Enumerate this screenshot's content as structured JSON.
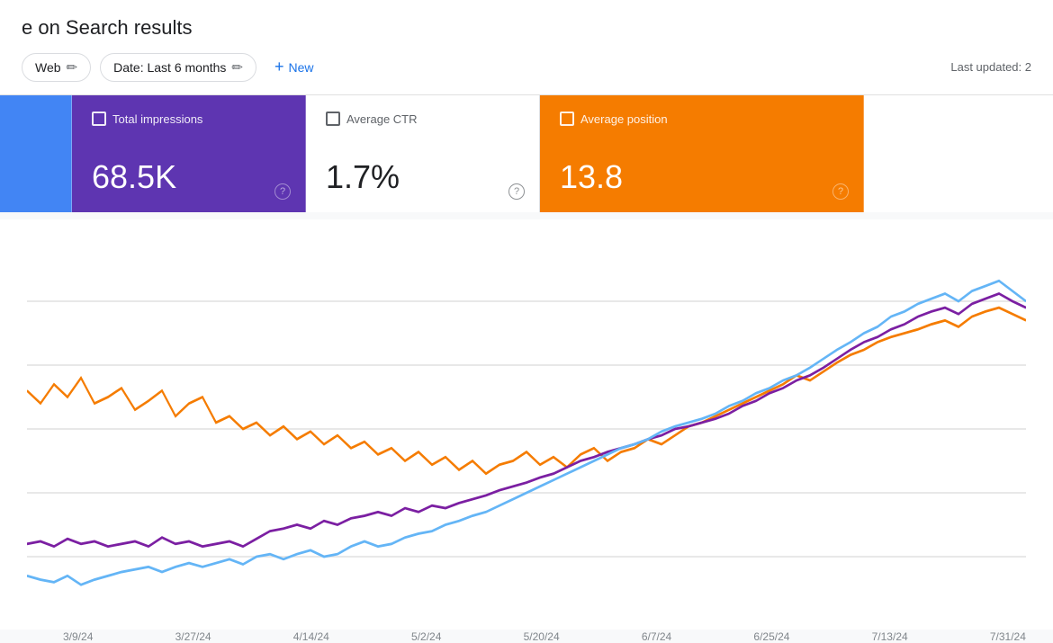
{
  "page": {
    "title": "e on Search results",
    "last_updated": "Last updated: 2"
  },
  "toolbar": {
    "filter_web_label": "Web",
    "filter_date_label": "Date: Last 6 months",
    "new_button_label": "New"
  },
  "metrics": [
    {
      "id": "total-clicks",
      "tile_color": "blue",
      "label": "",
      "value": "",
      "has_help": false
    },
    {
      "id": "total-impressions",
      "tile_color": "purple",
      "label": "Total impressions",
      "value": "68.5K",
      "has_help": true
    },
    {
      "id": "average-ctr",
      "tile_color": "white",
      "label": "Average CTR",
      "value": "1.7%",
      "has_help": true
    },
    {
      "id": "average-position",
      "tile_color": "orange",
      "label": "Average position",
      "value": "13.8",
      "has_help": true
    }
  ],
  "chart": {
    "x_labels": [
      "3/9/24",
      "3/27/24",
      "4/14/24",
      "5/2/24",
      "5/20/24",
      "6/7/24",
      "6/25/24",
      "7/13/24",
      "7/31/24"
    ],
    "colors": {
      "orange": "#f57c00",
      "purple": "#7b1fa2",
      "blue": "#64b5f6"
    }
  }
}
